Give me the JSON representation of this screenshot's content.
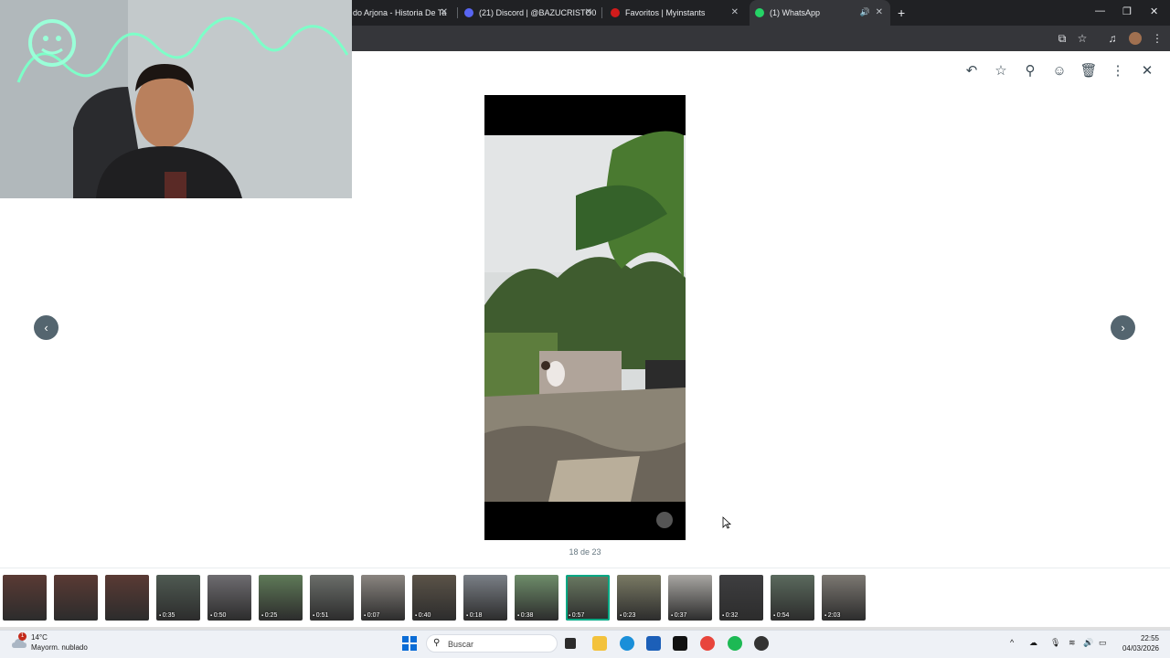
{
  "browser": {
    "tabs": [
      {
        "title": "do Arjona - Historia De Ta",
        "favicon_color": "#ff0000",
        "active": false
      },
      {
        "title": "(21) Discord | @BAZUCRISTO0",
        "favicon_color": "#5865f2",
        "active": false
      },
      {
        "title": "Favoritos | Myinstants",
        "favicon_color": "#d21b1b",
        "active": false
      },
      {
        "title": "(1) WhatsApp",
        "favicon_color": "#25d366",
        "active": true
      }
    ],
    "new_tab": "+",
    "minimize": "—",
    "restore": "❐",
    "close": "✕",
    "tab_close": "✕",
    "audio_icon": "🔊"
  },
  "viewer": {
    "header_icons": [
      "reply-icon",
      "star-icon",
      "pin-icon",
      "emoji-icon",
      "delete-icon",
      "more-icon",
      "close-icon"
    ],
    "header_glyphs": [
      "↶",
      "☆",
      "⚲",
      "☺",
      "🗑",
      "⋮",
      "✕"
    ],
    "counter": "18 de 23",
    "prev": "‹",
    "next": "›",
    "accent": "#00a884"
  },
  "thumbnails": [
    {
      "duration": "",
      "tone": "#5a3a34"
    },
    {
      "duration": "",
      "tone": "#5a3a34"
    },
    {
      "duration": "",
      "tone": "#5a3a34"
    },
    {
      "duration": "0:35",
      "tone": "#4f5a52"
    },
    {
      "duration": "0:50",
      "tone": "#6e6c70"
    },
    {
      "duration": "0:25",
      "tone": "#5f7a58"
    },
    {
      "duration": "0:51",
      "tone": "#6b6e6a"
    },
    {
      "duration": "0:07",
      "tone": "#8a8580"
    },
    {
      "duration": "0:40",
      "tone": "#5b5348"
    },
    {
      "duration": "0:18",
      "tone": "#7a7f86"
    },
    {
      "duration": "0:38",
      "tone": "#6e8d6a"
    },
    {
      "duration": "0:57",
      "tone": "#6a7a62",
      "selected": true
    },
    {
      "duration": "0:23",
      "tone": "#7a7a64"
    },
    {
      "duration": "0:37",
      "tone": "#a8a6a2"
    },
    {
      "duration": "0:32",
      "tone": "#3e3e40"
    },
    {
      "duration": "0:54",
      "tone": "#5b6a5e"
    },
    {
      "duration": "2:03",
      "tone": "#7c7872"
    }
  ],
  "taskbar": {
    "weather_temp": "14°C",
    "weather_desc": "Mayorm. nublado",
    "notif_count": "1",
    "search_label": "Buscar",
    "time": "22:55",
    "date": "04/03/2026"
  }
}
